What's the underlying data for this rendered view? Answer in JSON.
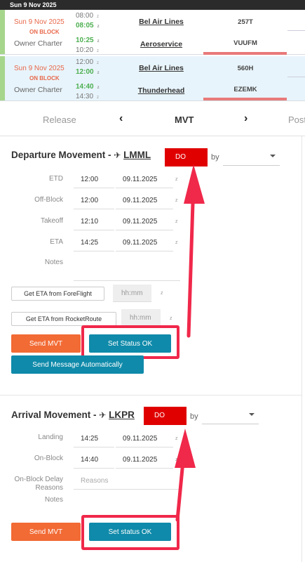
{
  "date_bar": "Sun 9 Nov 2025",
  "flights": [
    {
      "date": "Sun 9 Nov 2025",
      "status": "ON BLOCK",
      "type": "Owner Charter",
      "times": [
        {
          "value": "08:00",
          "z": "z"
        },
        {
          "value": "08:05",
          "z": "z"
        },
        {
          "value": "10:25",
          "z": "z"
        },
        {
          "value": "10:20",
          "z": "z"
        }
      ],
      "operator_1": "Bel Air Lines",
      "operator_2": "Aeroservice",
      "code": "257T",
      "registration": "VUUFM"
    },
    {
      "date": "Sun 9 Nov 2025",
      "status": "ON BLOCK",
      "type": "Owner Charter",
      "times": [
        {
          "value": "12:00",
          "z": "z"
        },
        {
          "value": "12:00",
          "z": "z"
        },
        {
          "value": "14:40",
          "z": "z"
        },
        {
          "value": "14:30",
          "z": "z"
        }
      ],
      "operator_1": "Bel Air Lines",
      "operator_2": "Thunderhead",
      "code": "560H",
      "registration": "EZEMK"
    }
  ],
  "tabs": {
    "release": "Release",
    "mvt": "MVT",
    "post": "Post",
    "prev": "‹",
    "next": "›"
  },
  "departure": {
    "title": "Departure Movement - ",
    "airport": "LMML",
    "status": "DO",
    "by": "by",
    "rows": [
      {
        "label": "ETD",
        "time": "12:00",
        "date": "09.11.2025",
        "z": "z"
      },
      {
        "label": "Off-Block",
        "time": "12:00",
        "date": "09.11.2025",
        "z": "z"
      },
      {
        "label": "Takeoff",
        "time": "12:10",
        "date": "09.11.2025",
        "z": "z"
      },
      {
        "label": "ETA",
        "time": "14:25",
        "date": "09.11.2025",
        "z": "z"
      }
    ],
    "notes_label": "Notes",
    "foreflight_btn": "Get ETA from ForeFlight",
    "foreflight_placeholder": "hh:mm",
    "rocketroute_btn": "Get ETA from RocketRoute",
    "rocketroute_placeholder": "hh:mm",
    "z": "z",
    "send_mvt": "Send MVT",
    "set_status": "Set Status OK",
    "send_auto": "Send Message Automatically"
  },
  "arrival": {
    "title": "Arrival Movement - ",
    "airport": "LKPR",
    "status": "DO",
    "by": "by",
    "rows": [
      {
        "label": "Landing",
        "time": "14:25",
        "date": "09.11.2025",
        "z": "z"
      },
      {
        "label": "On-Block",
        "time": "14:40",
        "date": "09.11.2025",
        "z": "z"
      }
    ],
    "delay_label": "On-Block Delay Reasons",
    "delay_placeholder": "Reasons",
    "notes_label": "Notes",
    "send_mvt": "Send MVT",
    "set_status": "Set status OK"
  },
  "colors": {
    "accent_red": "#f0284a",
    "status_red": "#e00000",
    "teal": "#0f8aaa",
    "orange": "#f26a34"
  }
}
